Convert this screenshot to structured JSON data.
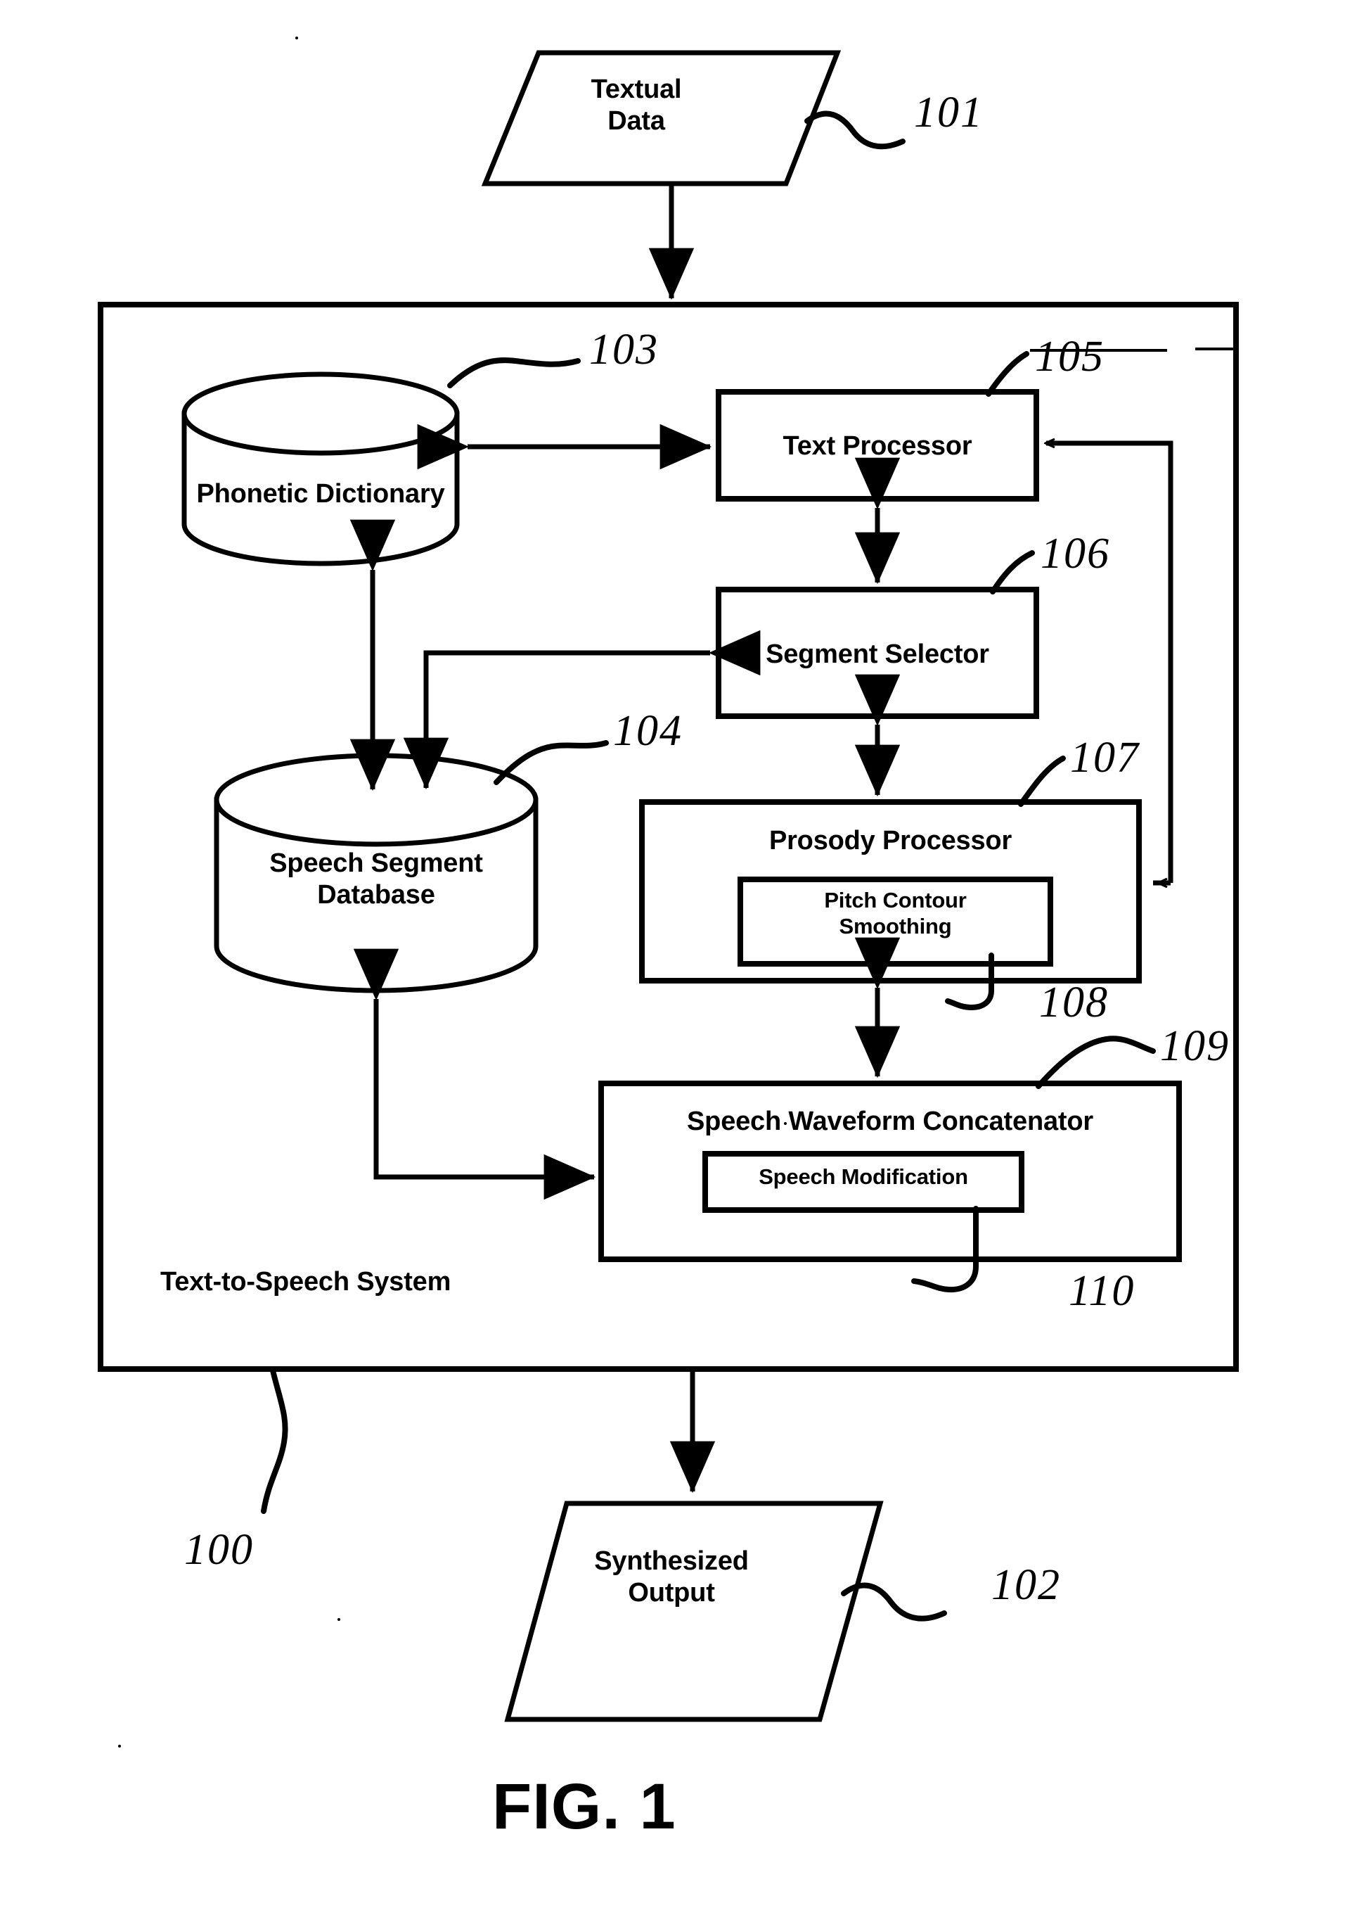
{
  "figure": {
    "caption": "FIG. 1",
    "system_label": "Text-to-Speech System"
  },
  "nodes": {
    "input": {
      "label": "Textual\nData",
      "ref": "101",
      "shape": "parallelogram"
    },
    "output": {
      "label": "Synthesized\nOutput",
      "ref": "102",
      "shape": "parallelogram"
    },
    "phonetic_dictionary": {
      "label": "Phonetic Dictionary",
      "ref": "103",
      "shape": "cylinder"
    },
    "speech_segment_database": {
      "label": "Speech Segment\nDatabase",
      "ref": "104",
      "shape": "cylinder"
    },
    "text_processor": {
      "label": "Text Processor",
      "ref": "105",
      "shape": "rectangle"
    },
    "segment_selector": {
      "label": "Segment Selector",
      "ref": "106",
      "shape": "rectangle"
    },
    "prosody_processor": {
      "label": "Prosody Processor",
      "ref": "107",
      "shape": "rectangle"
    },
    "pitch_contour_smoothing": {
      "label": "Pitch Contour\nSmoothing",
      "ref": "108",
      "shape": "rectangle"
    },
    "speech_waveform_concatenator": {
      "label": "Speech Waveform Concatenator",
      "ref": "109",
      "shape": "rectangle"
    },
    "speech_modification": {
      "label": "Speech Modification",
      "ref": "110",
      "shape": "rectangle"
    },
    "system_boundary": {
      "label": "Text-to-Speech System",
      "ref": "100",
      "shape": "rectangle"
    }
  },
  "colors": {
    "line": "#000000",
    "background": "#ffffff"
  }
}
